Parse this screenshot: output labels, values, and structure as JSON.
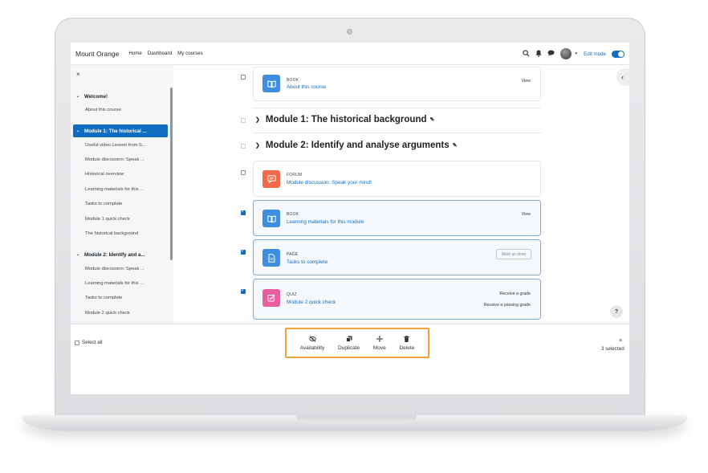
{
  "navbar": {
    "site_name": "Mount Orange",
    "links": [
      "Home",
      "Dashboard",
      "My courses"
    ],
    "edit_mode_label": "Edit mode",
    "edit_mode_on": true
  },
  "drawer": {
    "close_icon": "×",
    "sections": [
      {
        "title": "Welcome!",
        "items": [
          "About this course"
        ]
      },
      {
        "title": "Module 1: The historical ...",
        "active": true,
        "items": [
          "Useful video Lesson from S...",
          "Module discussion: Speak ...",
          "Historical overview",
          "Learning materials for this ...",
          "Tasks to complete",
          "Module 1 quick check",
          "The historical background"
        ]
      },
      {
        "title": "Module 2: Identify and a...",
        "items": [
          "Module discussion: Speak ...",
          "Learning materials for this ...",
          "Tasks to complete",
          "Module 2 quick check"
        ]
      }
    ]
  },
  "content": {
    "sections": [
      {
        "title": "Module 1: The historical background"
      },
      {
        "title": "Module 2: Identify and analyse arguments"
      }
    ],
    "activities": [
      {
        "type": "BOOK",
        "name": "About this course",
        "right": "View",
        "checked": false,
        "icon_color": "#3d8de0",
        "icon": "book-icon"
      },
      {
        "type": "FORUM",
        "name": "Module discussion: Speak your mind!",
        "right": "",
        "checked": false,
        "icon_color": "#f26a4a",
        "icon": "forum-icon"
      },
      {
        "type": "BOOK",
        "name": "Learning materials for this module",
        "right": "View",
        "checked": true,
        "icon_color": "#3d8de0",
        "icon": "book-icon"
      },
      {
        "type": "PAGE",
        "name": "Tasks to complete",
        "button": "Mark as done",
        "checked": true,
        "icon_color": "#3d8de0",
        "icon": "page-icon"
      },
      {
        "type": "QUIZ",
        "name": "Module 2 quick check",
        "right_lines": [
          "Receive a grade",
          "Receive a passing grade"
        ],
        "checked": true,
        "icon_color": "#e85fa0",
        "icon": "quiz-icon"
      }
    ]
  },
  "footer": {
    "select_all_label": "Select all",
    "actions": [
      {
        "label": "Availability",
        "icon": "eye-slash-icon"
      },
      {
        "label": "Duplicate",
        "icon": "copy-icon"
      },
      {
        "label": "Move",
        "icon": "move-icon"
      },
      {
        "label": "Delete",
        "icon": "trash-icon"
      }
    ],
    "selected_count": "3 selected",
    "close_icon": "×"
  },
  "help_label": "?",
  "colors": {
    "primary": "#0f6cbf",
    "highlight_border": "#f0a23a"
  }
}
